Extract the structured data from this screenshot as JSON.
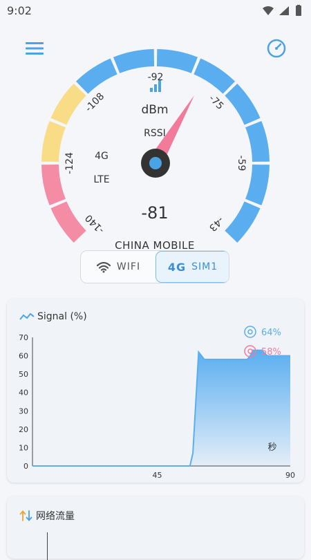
{
  "status_bar": {
    "time": "9:02"
  },
  "gauge": {
    "unit": "dBm",
    "metric": "RSSI",
    "value": "-81",
    "tech_line1": "4G",
    "tech_line2": "LTE",
    "operator": "CHINA MOBILE",
    "scale_labels": [
      "-140",
      "-124",
      "-108",
      "-92",
      "-75",
      "-59",
      "-43"
    ],
    "colors": {
      "weak": "#f48ca6",
      "fair": "#f8dd86",
      "good": "#5aaef0",
      "needle": "#f27a9a"
    }
  },
  "network_toggle": {
    "wifi_label": "WIFI",
    "sim_badge": "4G",
    "sim_label": "SIM1",
    "selected": "SIM1"
  },
  "signal_card": {
    "title": "Signal (%)",
    "legend": [
      {
        "value": "64%",
        "color": "#5aaef0"
      },
      {
        "value": "58%",
        "color": "#f27a9a"
      }
    ],
    "unit_label": "秒",
    "chart_data": {
      "type": "area",
      "x": [
        0,
        45,
        46,
        48,
        50,
        52,
        55,
        56,
        58,
        60,
        75,
        76,
        77,
        78,
        80,
        82,
        83,
        84,
        85,
        90
      ],
      "y": [
        0,
        0,
        0,
        0,
        0,
        0,
        0,
        7,
        62,
        58,
        58,
        60,
        63,
        63,
        63,
        60,
        60,
        60,
        60,
        60
      ],
      "xlim": [
        0,
        90
      ],
      "ylim": [
        0,
        70
      ],
      "x_ticks": [
        "45",
        "90"
      ],
      "y_ticks": [
        "0",
        "10",
        "20",
        "30",
        "40",
        "50",
        "60",
        "70"
      ],
      "color": "#5aaef0"
    }
  },
  "traffic_card": {
    "title": "网络流量"
  }
}
